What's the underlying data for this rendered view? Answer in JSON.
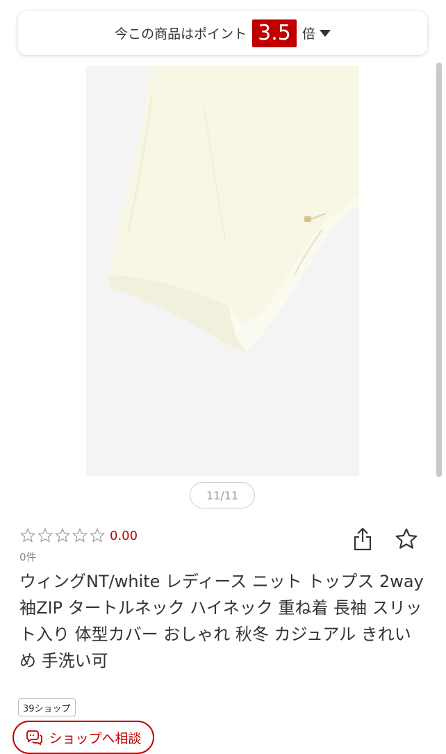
{
  "points_banner": {
    "prefix": "今この商品はポイント",
    "multiplier": "3.5",
    "suffix": "倍",
    "accent_color": "#bf0000"
  },
  "image_counter": {
    "text": "11/11"
  },
  "rating": {
    "stars_filled": 0,
    "stars_total": 5,
    "value": "0.00",
    "review_count": "0件"
  },
  "actions": {
    "share_icon": "share-icon",
    "favorite_icon": "star-outline-icon"
  },
  "product": {
    "title": "ウィングNT/white レディース ニット トップス 2way 袖ZIP タートルネック ハイネック 重ね着 長袖 スリット入り 体型カバー おしゃれ 秋冬 カジュアル きれいめ 手洗い可"
  },
  "shop": {
    "badge": "39ショップ",
    "consult_label": "ショップへ相談",
    "consult_icon": "chat-icon"
  }
}
